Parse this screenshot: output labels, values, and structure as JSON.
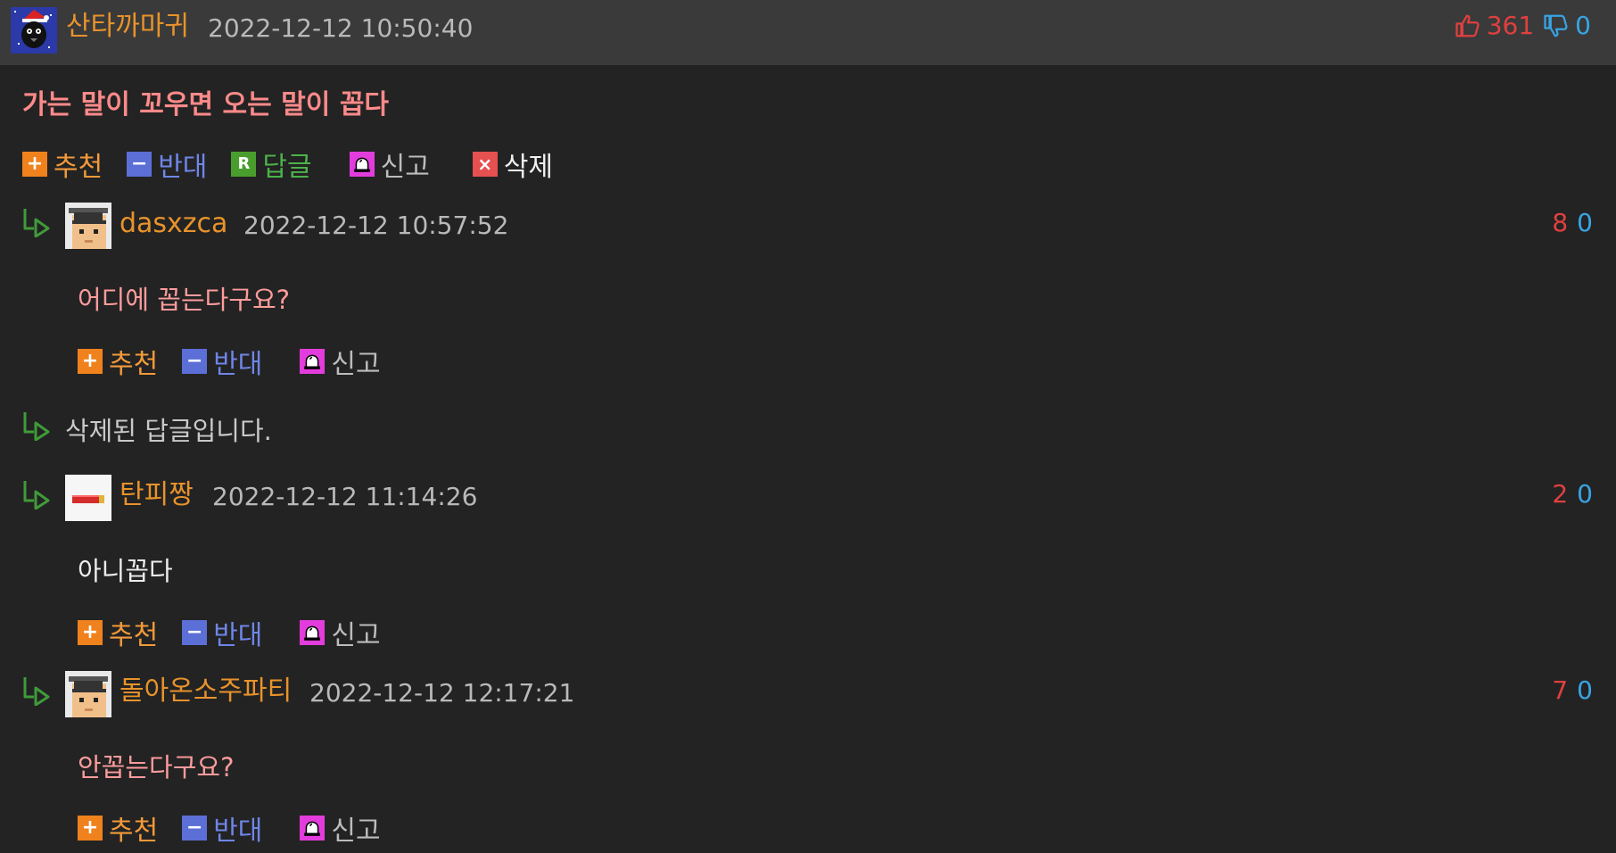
{
  "post": {
    "author": "산타까마귀",
    "timestamp": "2022-12-12 10:50:40",
    "likes": "361",
    "dislikes": "0",
    "title": "가는 말이 꼬우면 오는 말이 꼽다",
    "actions": {
      "recommend": "추천",
      "oppose": "반대",
      "reply": "답글",
      "report": "신고",
      "delete": "삭제"
    }
  },
  "icons": {
    "plus": "+",
    "minus": "−",
    "reply": "R",
    "delete": "×"
  },
  "comments": [
    {
      "author": "dasxzca",
      "timestamp": "2022-12-12 10:57:52",
      "text": "어디에 꼽는다구요?",
      "likes": "8",
      "dislikes": "0",
      "actions": {
        "recommend": "추천",
        "oppose": "반대",
        "report": "신고"
      }
    },
    {
      "deleted_text": "삭제된 답글입니다."
    },
    {
      "author": "탄피짱",
      "timestamp": "2022-12-12 11:14:26",
      "text": "아니꼽다",
      "likes": "2",
      "dislikes": "0",
      "actions": {
        "recommend": "추천",
        "oppose": "반대",
        "report": "신고"
      }
    },
    {
      "author": "돌아온소주파티",
      "timestamp": "2022-12-12 12:17:21",
      "text": "안꼽는다구요?",
      "likes": "7",
      "dislikes": "0",
      "actions": {
        "recommend": "추천",
        "oppose": "반대",
        "report": "신고"
      }
    }
  ],
  "colors": {
    "background": "#232323",
    "header_bar": "#3a3a3a",
    "username": "#e8932b",
    "title": "#ff8a8a",
    "like": "#e0403f",
    "dislike": "#38a4e4",
    "reply_arrow": "#3f9b3a"
  }
}
